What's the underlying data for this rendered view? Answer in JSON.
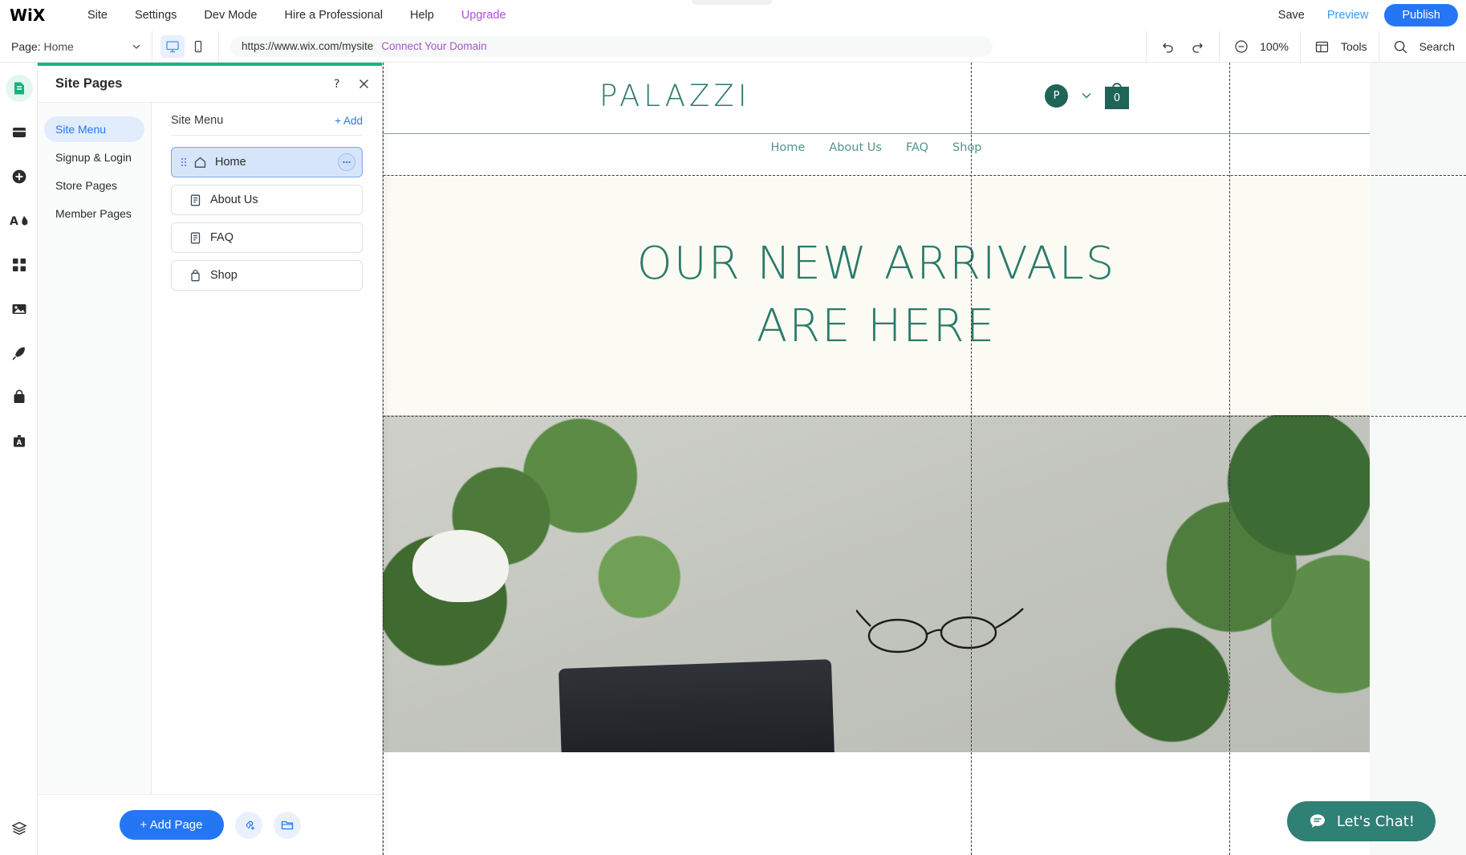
{
  "topbar": {
    "logo": "WiX",
    "menu": [
      {
        "label": "Site",
        "name": "menu-site"
      },
      {
        "label": "Settings",
        "name": "menu-settings"
      },
      {
        "label": "Dev Mode",
        "name": "menu-dev-mode"
      },
      {
        "label": "Hire a Professional",
        "name": "menu-hire-a-professional"
      },
      {
        "label": "Help",
        "name": "menu-help"
      },
      {
        "label": "Upgrade",
        "name": "menu-upgrade"
      }
    ],
    "save_label": "Save",
    "preview_label": "Preview",
    "publish_label": "Publish",
    "accent_publish": "#2576f5",
    "accent_upgrade": "#b14ed6"
  },
  "subbar": {
    "page_prefix": "Page:",
    "page_value": "Home",
    "desktop_icon": "desktop-icon",
    "mobile_icon": "mobile-icon",
    "url": "https://www.wix.com/mysite",
    "connect_domain": "Connect Your Domain",
    "undo_icon": "undo-icon",
    "redo_icon": "redo-icon",
    "zoom_level": "100%",
    "tools_label": "Tools",
    "search_label": "Search"
  },
  "rail": {
    "items": [
      {
        "name": "site-pages-icon",
        "label": "Site Pages",
        "active": true
      },
      {
        "name": "sections-icon",
        "label": "Sections",
        "active": false
      },
      {
        "name": "add-elements-icon",
        "label": "Add Elements",
        "active": false
      },
      {
        "name": "site-design-icon",
        "label": "Site Design",
        "active": false
      },
      {
        "name": "apps-icon",
        "label": "Apps",
        "active": false
      },
      {
        "name": "media-icon",
        "label": "Media",
        "active": false
      },
      {
        "name": "blog-icon",
        "label": "Blog",
        "active": false
      },
      {
        "name": "store-icon",
        "label": "Store",
        "active": false
      },
      {
        "name": "marketing-icon",
        "label": "Marketing",
        "active": false
      }
    ],
    "bottom": {
      "name": "layers-icon",
      "label": "Layers"
    }
  },
  "panel": {
    "title": "Site Pages",
    "help_icon": "help-icon",
    "close_icon": "close-icon",
    "accent": "#11b87f",
    "nav": [
      {
        "label": "Site Menu",
        "name": "panel-nav-site-menu",
        "active": true
      },
      {
        "label": "Signup & Login",
        "name": "panel-nav-signup-login",
        "active": false
      },
      {
        "label": "Store Pages",
        "name": "panel-nav-store-pages",
        "active": false
      },
      {
        "label": "Member Pages",
        "name": "panel-nav-member-pages",
        "active": false
      }
    ],
    "section_title": "Site Menu",
    "add_label": "+ Add",
    "pages": [
      {
        "label": "Home",
        "icon": "home-icon",
        "selected": true
      },
      {
        "label": "About Us",
        "icon": "page-icon",
        "selected": false
      },
      {
        "label": "FAQ",
        "icon": "page-icon",
        "selected": false
      },
      {
        "label": "Shop",
        "icon": "shop-bag-icon",
        "selected": false
      }
    ],
    "more_icon": "more-options-icon",
    "add_page_label": "+ Add Page",
    "link_icon": "add-link-icon",
    "folder_icon": "add-folder-icon"
  },
  "site": {
    "brand": "PALAZZI",
    "avatar_initial": "P",
    "chevron_icon": "chevron-down-icon",
    "cart_icon": "cart-bag-icon",
    "cart_count": "0",
    "nav": [
      "Home",
      "About Us",
      "FAQ",
      "Shop"
    ],
    "hero_line1": "OUR NEW ARRIVALS",
    "hero_line2": "ARE HERE",
    "hero_bg": "#fbfaf3",
    "brand_color": "#2b7a6b",
    "nav_color": "#4f968a",
    "chat_label": "Let's Chat!",
    "chat_icon": "chat-bubble-icon",
    "chat_color": "#2f8075"
  }
}
